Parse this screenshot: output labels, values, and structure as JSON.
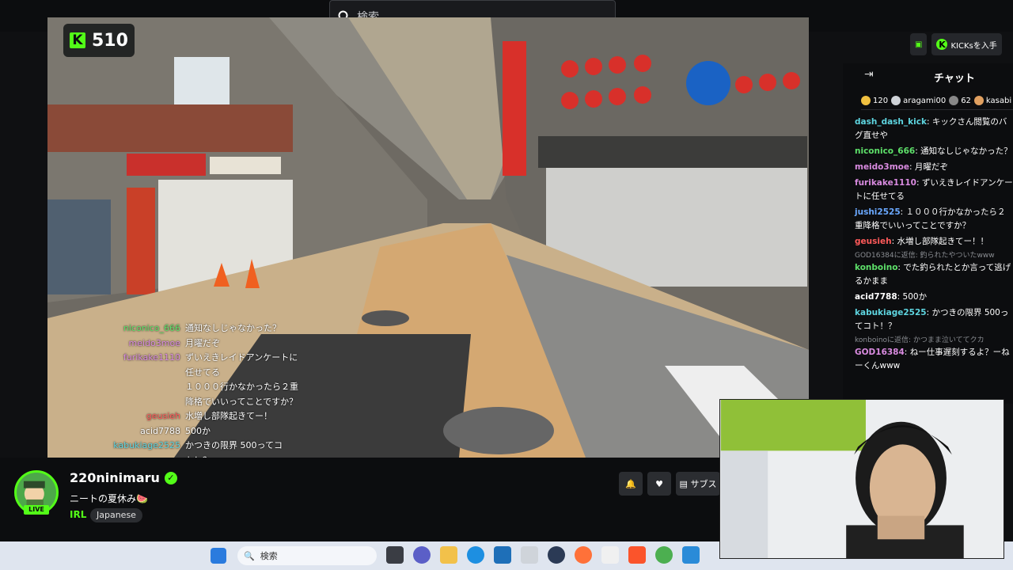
{
  "search": {
    "placeholder": "検索"
  },
  "viewer_count": "510",
  "topright": {
    "kicks_label": "KICKsを入手"
  },
  "overlay_chat": [
    {
      "user": "niconico_666",
      "color": "#5ee06a",
      "text": "通知なしじゃなかった？"
    },
    {
      "user": "meido3moe",
      "color": "#d98be0",
      "text": "月曜だぞ"
    },
    {
      "user": "furikake1110",
      "color": "#d98be0",
      "text": "ずいえきレイドアンケートに"
    },
    {
      "user": "",
      "color": "#ffffff",
      "text": "任せてる"
    },
    {
      "user": "",
      "color": "#ffffff",
      "text": "１０００行かなかったら２重"
    },
    {
      "user": "",
      "color": "#ffffff",
      "text": "降格でいいってことですか？"
    },
    {
      "user": "geusieh",
      "color": "#ff5a5a",
      "text": "水増し部隊起きてー！"
    },
    {
      "user": "acid7788",
      "color": "#ffffff",
      "text": "500か"
    },
    {
      "user": "kabukiage2525",
      "color": "#5ed5e0",
      "text": "かつきの限界 500ってコ"
    },
    {
      "user": "",
      "color": "#ffffff",
      "text": "ト！？"
    }
  ],
  "chat": {
    "title": "チャット",
    "leaderboard": [
      {
        "label": "120",
        "color": "#f0c040"
      },
      {
        "label": "aragami00",
        "color": "#cfd3d8"
      },
      {
        "label": "62",
        "color": "#888"
      },
      {
        "label": "kasabi",
        "color": "#e0a060"
      }
    ],
    "messages": [
      {
        "user": "dash_dash_kick",
        "color": "#5ed5e0",
        "text": "キックさん閲覧のバグ直せや"
      },
      {
        "user": "niconico_666",
        "color": "#5ee06a",
        "text": "通知なしじゃなかった？"
      },
      {
        "user": "meido3moe",
        "color": "#d98be0",
        "text": "月曜だぞ"
      },
      {
        "user": "furikake1110",
        "color": "#d98be0",
        "text": "ずいえきレイドアンケートに任せてる"
      },
      {
        "user": "jushi2525",
        "color": "#6aa8ff",
        "text": "１０００行かなかったら２重降格でいいってことですか？"
      },
      {
        "user": "geusieh",
        "color": "#ff5a5a",
        "text": "水増し部隊起きてー！！"
      },
      {
        "user": "konboino",
        "color": "#5ee06a",
        "text": "でた釣られたとか言って逃げるかまま",
        "reply": "GOD16384に返信: 釣られたやついたwww"
      },
      {
        "user": "acid7788",
        "color": "#ffffff",
        "text": "500か"
      },
      {
        "user": "kabukiage2525",
        "color": "#5ed5e0",
        "text": "かつきの限界 500ってコト！？"
      },
      {
        "user": "GOD16384",
        "color": "#d98be0",
        "text": "ねー仕事遅刻するよ？ーねーくんwww",
        "reply": "konboinoに返信: かつまま泣いててクカ"
      }
    ]
  },
  "channel": {
    "name": "220ninimaru",
    "title": "ニートの夏休み🍉",
    "category": "IRL",
    "tag": "Japanese",
    "live_label": "LIVE",
    "subscribe_label": "サブス"
  },
  "taskbar": {
    "search_placeholder": "検索"
  },
  "colors": {
    "accent": "#53fc18",
    "background": "#0c0d0f"
  }
}
